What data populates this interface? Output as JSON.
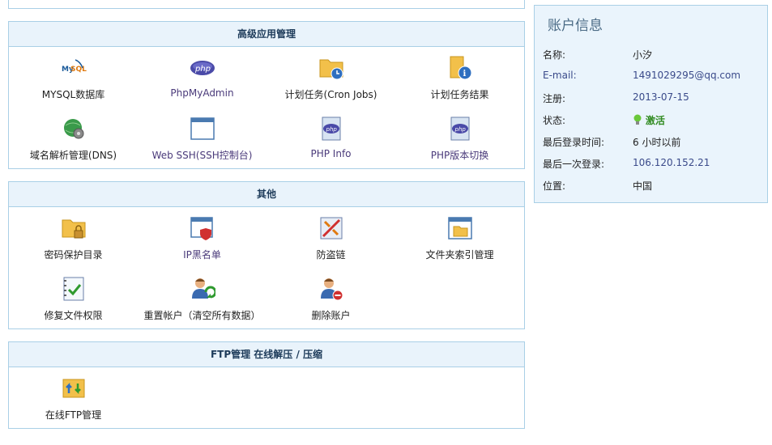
{
  "sections": {
    "advanced": {
      "title": "高级应用管理",
      "items": [
        {
          "label": "MYSQL数据库",
          "icon": "mysql-icon"
        },
        {
          "label": "PhpMyAdmin",
          "icon": "php-icon"
        },
        {
          "label": "计划任务(Cron Jobs)",
          "icon": "folder-clock-icon"
        },
        {
          "label": "计划任务结果",
          "icon": "folder-info-icon"
        },
        {
          "label": "域名解析管理(DNS)",
          "icon": "globe-gear-icon"
        },
        {
          "label": "Web SSH(SSH控制台)",
          "icon": "window-icon"
        },
        {
          "label": "PHP Info",
          "icon": "php-info-icon"
        },
        {
          "label": "PHP版本切换",
          "icon": "php-switch-icon"
        }
      ]
    },
    "other": {
      "title": "其他",
      "items": [
        {
          "label": "密码保护目录",
          "icon": "folder-lock-icon"
        },
        {
          "label": "IP黑名单",
          "icon": "window-shield-icon"
        },
        {
          "label": "防盗链",
          "icon": "anti-leech-icon"
        },
        {
          "label": "文件夹索引管理",
          "icon": "folder-index-icon"
        },
        {
          "label": "修复文件权限",
          "icon": "notebook-check-icon"
        },
        {
          "label": "重置帐户（清空所有数据）",
          "icon": "user-reset-icon"
        },
        {
          "label": "删除账户",
          "icon": "user-delete-icon"
        }
      ]
    },
    "ftp": {
      "title": "FTP管理 在线解压 / 压缩",
      "items": [
        {
          "label": "在线FTP管理",
          "icon": "ftp-icon"
        }
      ]
    }
  },
  "account": {
    "title": "账户信息",
    "rows": [
      {
        "key": "名称:",
        "value": "小汐"
      },
      {
        "key": "E-mail:",
        "value": "1491029295@qq.com"
      },
      {
        "key": "注册:",
        "value": "2013-07-15"
      },
      {
        "key": "状态:",
        "value": "激活"
      },
      {
        "key": "最后登录时间:",
        "value": "6 小时以前"
      },
      {
        "key": "最后一次登录:",
        "value": "106.120.152.21"
      },
      {
        "key": "位置:",
        "value": "中国"
      }
    ]
  },
  "colors": {
    "border": "#a9cfe6",
    "header_bg": "#e9f3fb",
    "account_bg": "#eaf4fc",
    "active": "#2f8a1f"
  }
}
